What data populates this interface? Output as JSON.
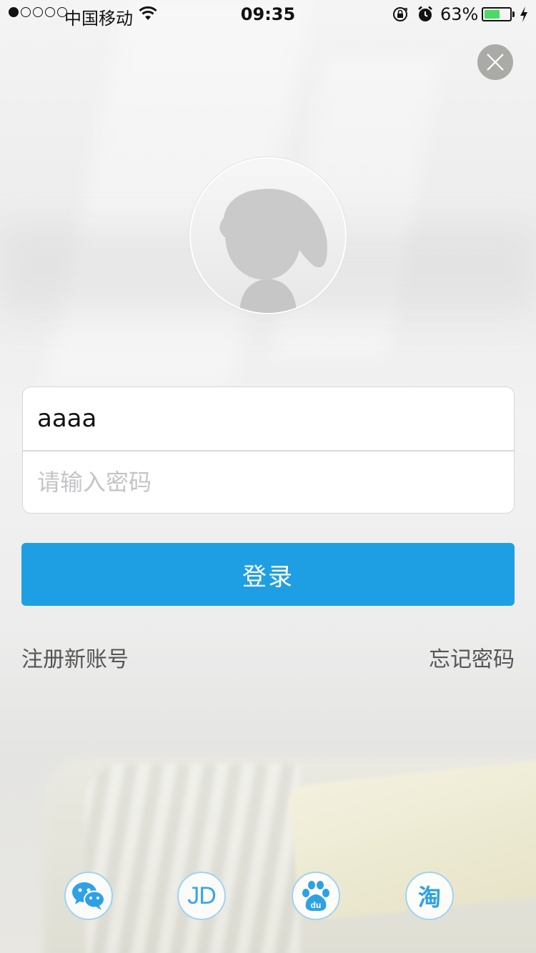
{
  "status_bar": {
    "carrier": "中国移动",
    "time": "09:35",
    "battery_percent": "63%",
    "battery_level": 0.63
  },
  "close_button": {
    "icon": "close-icon"
  },
  "avatar": {
    "icon": "default-avatar-icon"
  },
  "login_form": {
    "username_value": "aaaa",
    "password_placeholder": "请输入密码"
  },
  "login_button": {
    "label": "登录"
  },
  "links": {
    "register": "注册新账号",
    "forgot_password": "忘记密码"
  },
  "third_party_logins": {
    "wechat_icon": "wechat-icon",
    "jd_label": "JD",
    "baidu_icon": "baidu-paw-icon",
    "taobao_label": "淘"
  },
  "colors": {
    "accent": "#1e9fe4",
    "social_icon": "#2ea1e5",
    "battery_fill": "#4cd964"
  }
}
